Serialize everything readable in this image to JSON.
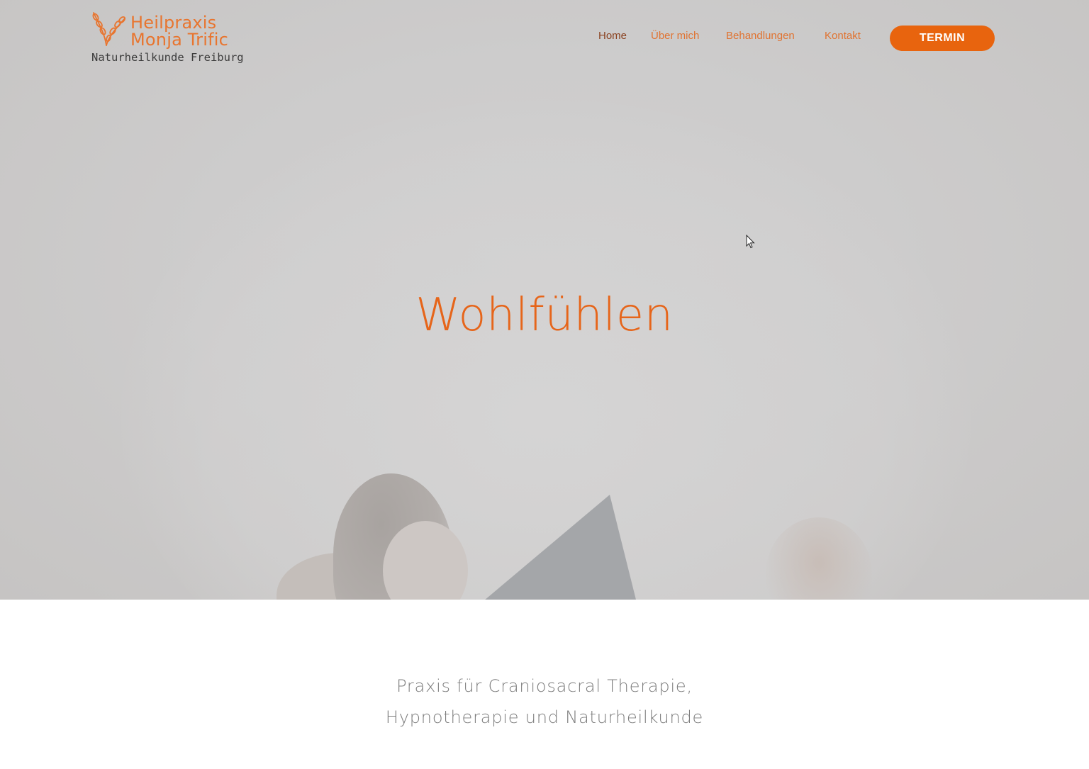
{
  "header": {
    "logo": {
      "name_line1": "Heilpraxis",
      "name_line2": "Monja Trific",
      "subtitle": "Naturheilkunde Freiburg"
    },
    "nav": {
      "items": [
        {
          "label": "Home",
          "active": true
        },
        {
          "label": "Über mich",
          "active": false
        },
        {
          "label": "Behandlungen",
          "active": false
        },
        {
          "label": "Kontakt",
          "active": false
        }
      ]
    },
    "cta_label": "TERMIN"
  },
  "hero": {
    "title": "Wohlfühlen"
  },
  "intro": {
    "line1": "Praxis für Craniosacral Therapie,",
    "line2": "Hypnotherapie und Naturheilkunde"
  },
  "colors": {
    "accent": "#e8640e",
    "nav_text": "#e07331",
    "nav_active": "#8a4220",
    "hero_bg": "#cdcccc",
    "intro_text": "#7d7d7d"
  },
  "icons": {
    "logo_mark": "leaf-branch-icon",
    "cursor": "mouse-pointer-icon"
  }
}
